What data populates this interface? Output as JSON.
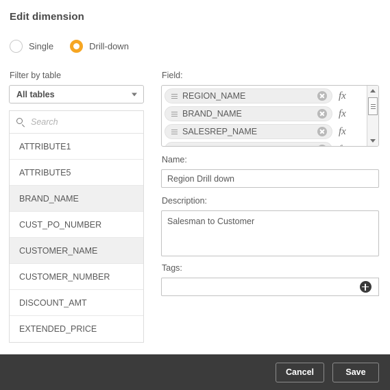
{
  "dialog": {
    "title": "Edit dimension"
  },
  "dimension_type": {
    "options": [
      {
        "label": "Single",
        "selected": false
      },
      {
        "label": "Drill-down",
        "selected": true
      }
    ],
    "accent_color": "#f6a623"
  },
  "left_panel": {
    "filter_label": "Filter by table",
    "table_select": {
      "value": "All tables",
      "caret_icon": "chevron-down-icon"
    },
    "search": {
      "value": "",
      "placeholder": "Search",
      "icon": "search-icon"
    },
    "fields": [
      {
        "name": "ATTRIBUTE1",
        "used": false
      },
      {
        "name": "ATTRIBUTE5",
        "used": false
      },
      {
        "name": "BRAND_NAME",
        "used": true
      },
      {
        "name": "CUST_PO_NUMBER",
        "used": false
      },
      {
        "name": "CUSTOMER_NAME",
        "used": true
      },
      {
        "name": "CUSTOMER_NUMBER",
        "used": false
      },
      {
        "name": "DISCOUNT_AMT",
        "used": false
      },
      {
        "name": "EXTENDED_PRICE",
        "used": false
      }
    ]
  },
  "right_panel": {
    "field_label": "Field:",
    "selected_fields": [
      {
        "name": "REGION_NAME",
        "drag_icon": "drag-handle-icon",
        "clear_icon": "clear-circle-icon",
        "expression_label": "fx"
      },
      {
        "name": "BRAND_NAME",
        "drag_icon": "drag-handle-icon",
        "clear_icon": "clear-circle-icon",
        "expression_label": "fx"
      },
      {
        "name": "SALESREP_NAME",
        "drag_icon": "drag-handle-icon",
        "clear_icon": "clear-circle-icon",
        "expression_label": "fx"
      }
    ],
    "name_label": "Name:",
    "name_value": "Region Drill down",
    "description_label": "Description:",
    "description_value": "Salesman to Customer",
    "tags_label": "Tags:",
    "tags_value": "",
    "add_tag_icon": "plus-circle-icon"
  },
  "footer": {
    "cancel_label": "Cancel",
    "save_label": "Save",
    "background_color": "#3b3b3b"
  }
}
